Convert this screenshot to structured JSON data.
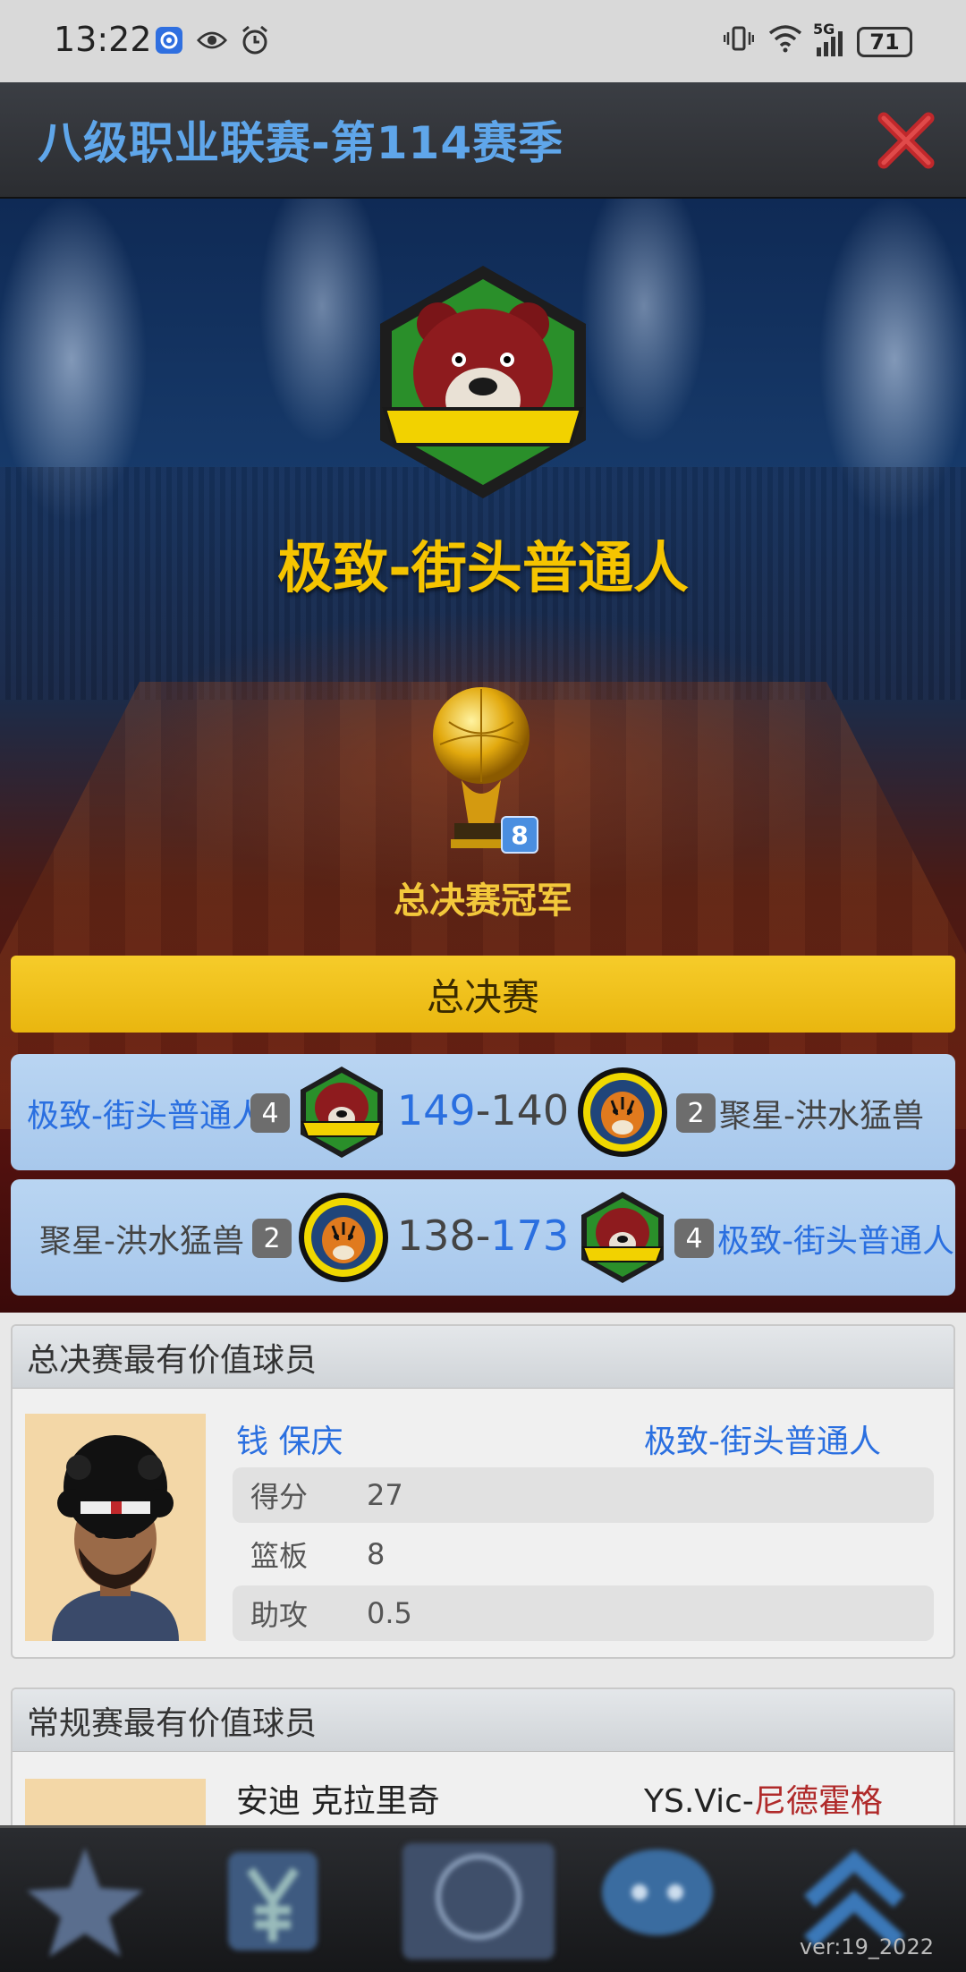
{
  "status_bar": {
    "time": "13:22",
    "battery": "71",
    "network": "5G"
  },
  "header": {
    "title": "八级职业联赛-第114赛季"
  },
  "champion": {
    "team_name": "极致-街头普通人",
    "trophy_count": "8",
    "label": "总决赛冠军"
  },
  "finals": {
    "header": "总决赛",
    "games": [
      {
        "left_team": "极致-街头普通人",
        "left_num": "4",
        "left_score": "149",
        "dash": "-",
        "right_score": "140",
        "right_num": "2",
        "right_team": "聚星-洪水猛兽"
      },
      {
        "left_team": "聚星-洪水猛兽",
        "left_num": "2",
        "left_score": "138",
        "dash": "-",
        "right_score": "173",
        "right_num": "4",
        "right_team": "极致-街头普通人"
      }
    ]
  },
  "finals_mvp": {
    "header": "总决赛最有价值球员",
    "player": "钱 保庆",
    "team": "极致-街头普通人",
    "stats": [
      {
        "label": "得分",
        "value": "27"
      },
      {
        "label": "篮板",
        "value": "8"
      },
      {
        "label": "助攻",
        "value": "0.5"
      }
    ]
  },
  "regular_mvp": {
    "header": "常规赛最有价值球员",
    "player": "安迪 克拉里奇",
    "team_prefix": "YS.Vic-",
    "team_suffix": "尼德霍格"
  },
  "footer": {
    "version": "ver:19_2022"
  },
  "colors": {
    "accent_blue": "#2a6fe0",
    "gold": "#f5c400",
    "red": "#c0282b"
  }
}
